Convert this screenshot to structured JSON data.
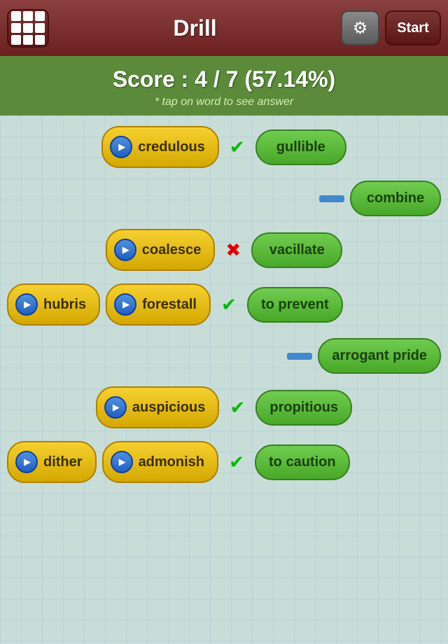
{
  "header": {
    "title": "Drill",
    "start_label": "Start"
  },
  "score": {
    "label": "Score  :  4 / 7 (57.14%)",
    "hint": "* tap on word to see answer"
  },
  "rows": [
    {
      "id": "credulous",
      "word": "credulous",
      "answer": "gullible",
      "status": "check",
      "layout": "center-right"
    },
    {
      "id": "combine",
      "word": null,
      "answer": "combine",
      "status": "dash",
      "layout": "right-only"
    },
    {
      "id": "coalesce",
      "word": "coalesce",
      "answer": "vacillate",
      "status": "cross",
      "layout": "center-right"
    },
    {
      "id": "hubris-forestall",
      "word_left": "hubris",
      "word_right": "forestall",
      "answer": "to prevent",
      "status": "check",
      "layout": "double"
    },
    {
      "id": "arrogant",
      "word": null,
      "answer": "arrogant pride",
      "status": "dash",
      "layout": "right-only"
    },
    {
      "id": "auspicious",
      "word": "auspicious",
      "answer": "propitious",
      "status": "check",
      "layout": "center-right"
    },
    {
      "id": "dither-admonish",
      "word_left": "dither",
      "word_right": "admonish",
      "answer": "to caution",
      "status": "check",
      "layout": "double"
    }
  ]
}
